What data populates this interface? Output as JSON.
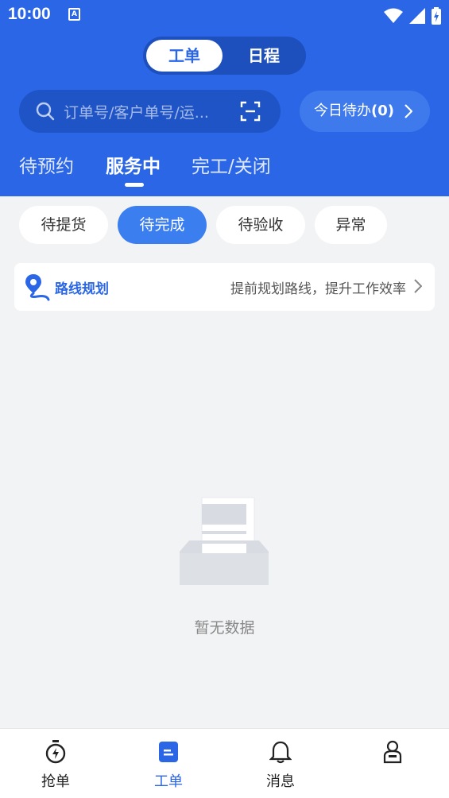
{
  "status_bar": {
    "time": "10:00",
    "notif_badge": "A"
  },
  "segment": {
    "items": [
      "工单",
      "日程"
    ],
    "selected": "工单"
  },
  "search": {
    "placeholder": "订单号/客户单号/运..."
  },
  "todo": {
    "label": "今日待办",
    "count": "(0)"
  },
  "tabs": [
    "待预约",
    "服务中",
    "完工/关闭"
  ],
  "active_tab": "服务中",
  "chips": [
    "待提货",
    "待完成",
    "待验收",
    "异常"
  ],
  "active_chip": "待完成",
  "route": {
    "title": "路线规划",
    "description": "提前规划路线，提升工作效率"
  },
  "empty": {
    "text": "暂无数据"
  },
  "bottom_nav": {
    "items": [
      {
        "label": "抢单",
        "icon": "stopwatch-icon"
      },
      {
        "label": "工单",
        "icon": "document-icon"
      },
      {
        "label": "消息",
        "icon": "bell-icon"
      },
      {
        "label": "",
        "icon": "profile-icon"
      }
    ],
    "active": "工单"
  },
  "colors": {
    "primary": "#2a66e6",
    "active_chip": "#3b7ef0",
    "background": "#f2f3f5"
  }
}
